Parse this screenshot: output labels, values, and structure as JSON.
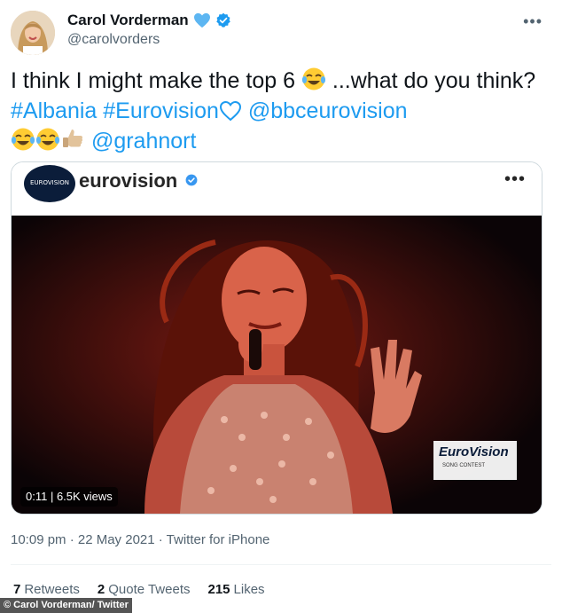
{
  "tweet": {
    "author_name": "Carol Vorderman",
    "author_handle": "@carolvorders",
    "more_label": "•••",
    "text_part1": "I think I might make the top 6",
    "text_part2": " ...what do you think?",
    "hashtag_albania": "#Albania",
    "hashtag_eurovision": "#Eurovision",
    "mention_bbc": "@bbceurovision",
    "mention_grahnort": "@grahnort",
    "timestamp": "10:09 pm · 22 May 2021 · Twitter for iPhone",
    "stats": {
      "retweets_count": "7",
      "retweets_label": "Retweets",
      "quotes_count": "2",
      "quotes_label": "Quote Tweets",
      "likes_count": "215",
      "likes_label": "Likes"
    }
  },
  "card": {
    "account_name": "eurovision",
    "more_label": "•••",
    "video_badge": "0:11 | 6.5K views",
    "logo_text": "EUROVISION",
    "watermark_text": "EuroVision",
    "watermark_sub": "SONG CONTEST"
  },
  "credit": "© Carol Vorderman/ Twitter",
  "colors": {
    "link": "#1d9bf0",
    "verified": "#1d9bf0",
    "heart": "#5db6f2"
  }
}
